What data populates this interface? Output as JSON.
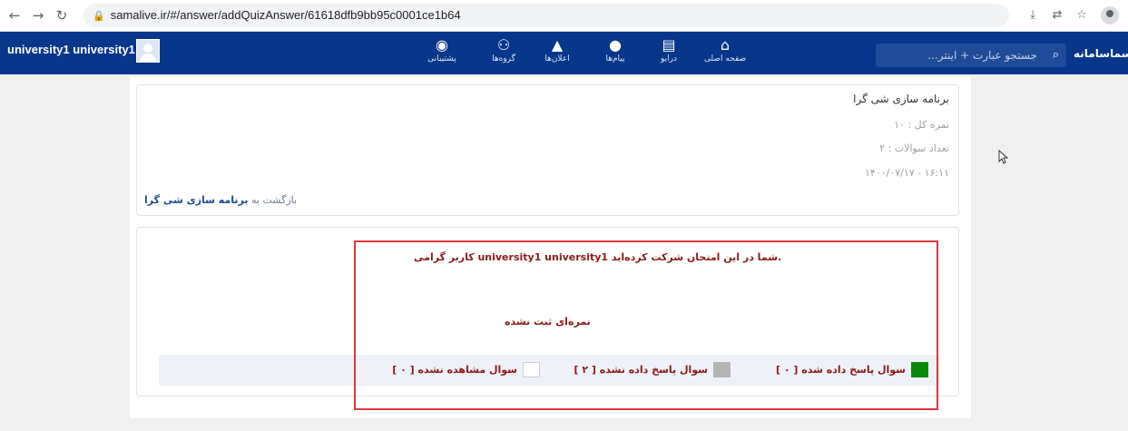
{
  "browser": {
    "url": "samalive.ir/#/answer/addQuizAnswer/61618dfb9bb95c0001ce1b64",
    "icons": [
      "back-arrow-icon",
      "forward-arrow-icon",
      "reload-icon",
      "lock-icon",
      "install-icon",
      "translate-icon",
      "star-icon",
      "profile-icon"
    ]
  },
  "header": {
    "user_name": "university1 university1",
    "nav": [
      {
        "label": "پشتیبانی",
        "icon": "rss-icon"
      },
      {
        "label": "گروه‌ها",
        "icon": "groups-icon"
      },
      {
        "label": "اعلان‌ها",
        "icon": "bell-icon"
      },
      {
        "label": "پیام‌ها",
        "icon": "chat-icon"
      },
      {
        "label": "درایو",
        "icon": "drive-icon"
      },
      {
        "label": "صفحه اصلی",
        "icon": "home-icon"
      }
    ],
    "search_placeholder": "جستجو عبارت + اینتر...",
    "logo_text": "سماسامانه"
  },
  "quiz": {
    "title": "برنامه سازی شی گرا",
    "total_score": "نمره کل : ۱۰",
    "question_count": "تعداد سوالات : ۲",
    "datetime": "۱۶:۱۱ - ۱۴۰۰/۰۷/۱۷",
    "back_prefix": "بازگشت به",
    "back_link": "برنامه سازی شی گرا"
  },
  "result": {
    "message": "کاربر گرامی university1 university1 شما در این امتحان شرکت کرده‌اید.",
    "no_score": "نمره‌ای ثبت نشده",
    "legend": [
      {
        "label": "سوال پاسخ داده شده [ ۰ ]",
        "color": "#0a8a0a"
      },
      {
        "label": "سوال پاسخ داده نشده [ ۲ ]",
        "color": "#b5b5b5"
      },
      {
        "label": "سوال مشاهده نشده [ ۰ ]",
        "color": "#ffffff"
      }
    ]
  },
  "colors": {
    "header_bg": "#07368b",
    "accent_text": "#8b1a1a",
    "highlight": "#e0353a"
  }
}
